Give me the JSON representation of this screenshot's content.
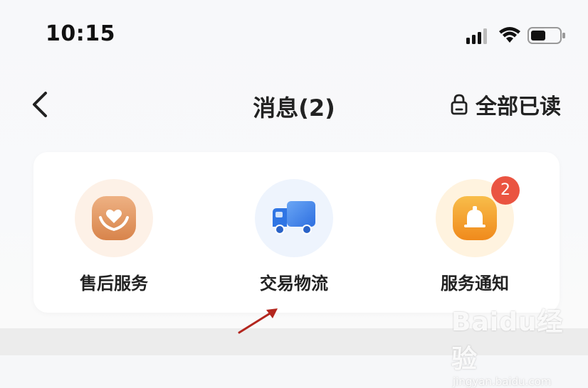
{
  "status_bar": {
    "time": "10:15",
    "icons": [
      "signal-icon",
      "wifi-icon",
      "battery-icon"
    ]
  },
  "nav": {
    "back_icon": "chevron-left-icon",
    "title": "消息(2)",
    "mark_all_read_icon": "lock-icon",
    "mark_all_read_label": "全部已读"
  },
  "categories": [
    {
      "label": "售后服务",
      "icon": "heart-hands-icon",
      "color": "#e2955f"
    },
    {
      "label": "交易物流",
      "icon": "truck-icon",
      "color": "#3a7fe6"
    },
    {
      "label": "服务通知",
      "icon": "bell-icon",
      "color": "#f3a12f",
      "badge": "2"
    }
  ],
  "colors": {
    "badge": "#ea5441",
    "annotation_arrow": "#b3261e"
  },
  "watermark": {
    "main": "Baidu经验",
    "sub": "jingyan.baidu.com"
  }
}
